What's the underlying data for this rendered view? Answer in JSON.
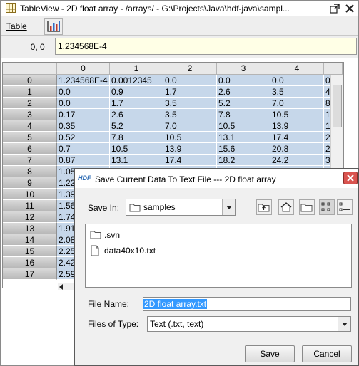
{
  "window": {
    "title": "TableView  -  2D float array  -  /arrays/  -  G:\\Projects\\Java\\hdf-java\\sampl..."
  },
  "menubar": {
    "table_label": "Table",
    "chart_icon": "chart-icon"
  },
  "cellbar": {
    "label": "0, 0  =",
    "value": "1.234568E-4"
  },
  "table": {
    "columns": [
      "0",
      "1",
      "2",
      "3",
      "4",
      ""
    ],
    "rows": [
      {
        "header": "0",
        "cells": [
          "1.234568E-4",
          "0.0012345",
          "0.0",
          "0.0",
          "0.0",
          "0"
        ]
      },
      {
        "header": "1",
        "cells": [
          "0.0",
          "0.9",
          "1.7",
          "2.6",
          "3.5",
          "4"
        ]
      },
      {
        "header": "2",
        "cells": [
          "0.0",
          "1.7",
          "3.5",
          "5.2",
          "7.0",
          "8"
        ]
      },
      {
        "header": "3",
        "cells": [
          "0.17",
          "2.6",
          "3.5",
          "7.8",
          "10.5",
          "1"
        ]
      },
      {
        "header": "4",
        "cells": [
          "0.35",
          "5.2",
          "7.0",
          "10.5",
          "13.9",
          "1"
        ]
      },
      {
        "header": "5",
        "cells": [
          "0.52",
          "7.8",
          "10.5",
          "13.1",
          "17.4",
          "2"
        ]
      },
      {
        "header": "6",
        "cells": [
          "0.7",
          "10.5",
          "13.9",
          "15.6",
          "20.8",
          "2"
        ]
      },
      {
        "header": "7",
        "cells": [
          "0.87",
          "13.1",
          "17.4",
          "18.2",
          "24.2",
          "3"
        ]
      },
      {
        "header": "8",
        "cells": [
          "1.05",
          "",
          "",
          "",
          "",
          ""
        ]
      },
      {
        "header": "9",
        "cells": [
          "1.22",
          "",
          "",
          "",
          "",
          ""
        ]
      },
      {
        "header": "10",
        "cells": [
          "1.39",
          "",
          "",
          "",
          "",
          ""
        ]
      },
      {
        "header": "11",
        "cells": [
          "1.56",
          "",
          "",
          "",
          "",
          ""
        ]
      },
      {
        "header": "12",
        "cells": [
          "1.74",
          "",
          "",
          "",
          "",
          ""
        ]
      },
      {
        "header": "13",
        "cells": [
          "1.91",
          "",
          "",
          "",
          "",
          ""
        ]
      },
      {
        "header": "14",
        "cells": [
          "2.08",
          "",
          "",
          "",
          "",
          ""
        ]
      },
      {
        "header": "15",
        "cells": [
          "2.25",
          "",
          "",
          "",
          "",
          ""
        ]
      },
      {
        "header": "16",
        "cells": [
          "2.42",
          "",
          "",
          "",
          "",
          ""
        ]
      },
      {
        "header": "17",
        "cells": [
          "2.59",
          "",
          "",
          "",
          "",
          ""
        ]
      }
    ]
  },
  "dialog": {
    "title": "Save Current Data To Text File --- 2D float array",
    "hdf_badge": "HDF",
    "save_in_label": "Save In:",
    "save_in_value": "samples",
    "files": [
      {
        "name": ".svn",
        "icon": "folder-icon"
      },
      {
        "name": "data40x10.txt",
        "icon": "file-icon"
      }
    ],
    "file_name_label": "File Name:",
    "file_name_value": "2D float array.txt",
    "files_of_type_label": "Files of Type:",
    "files_of_type_value": "Text (.txt, text)",
    "save_button": "Save",
    "cancel_button": "Cancel"
  }
}
